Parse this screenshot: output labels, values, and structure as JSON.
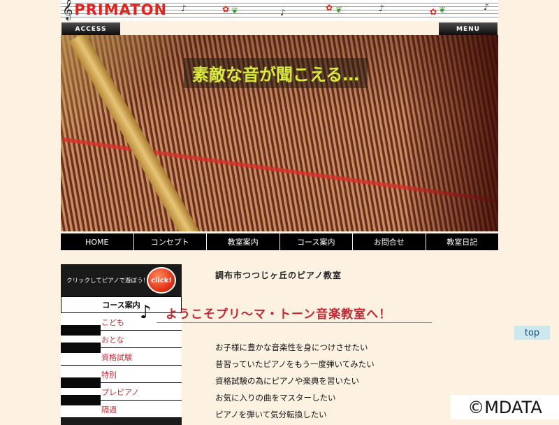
{
  "header": {
    "logo_text": "PRIMATON",
    "clef_glyph": "𝄞",
    "note_glyph": "♪",
    "flower_glyph": "✿",
    "leaf_glyph": "❦"
  },
  "top_buttons": {
    "access": "ACCESS",
    "menu": "MENU"
  },
  "hero": {
    "caption": "素敵な音が聞こえる…"
  },
  "nav": {
    "items": [
      "HOME",
      "コンセプト",
      "教室案内",
      "コース案内",
      "お問合せ",
      "教室日記"
    ]
  },
  "sidebar": {
    "banner_text": "クリックしてピアノで遊ぼう！",
    "click_label": "click!",
    "course_heading": "コース案内",
    "items": [
      "こども",
      "おとな",
      "資格試験",
      "特別",
      "プレピアノ",
      "隔週"
    ]
  },
  "main": {
    "title": "調布市つつじヶ丘のピアノ教室",
    "welcome_note": "♪",
    "welcome": "ようこそプリ～マ・トーン音楽教室へ！",
    "features": [
      "お子様に豊かな音楽性を身につけさせたい",
      "昔習っていたピアノをもう一度弾いてみたい",
      "資格試験の為にピアノや楽典を習いたい",
      "お気に入りの曲をマスターしたい",
      "ピアノを弾いて気分転換したい"
    ]
  },
  "top_link": "top",
  "watermark": "©MDATA",
  "colors": {
    "accent_red": "#c22a33",
    "page_bg": "#fdf1e2",
    "nav_bg": "#000000"
  }
}
